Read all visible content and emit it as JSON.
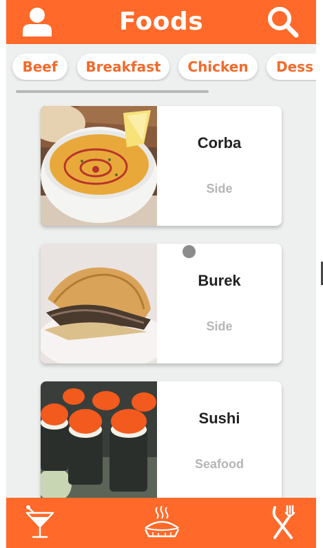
{
  "header": {
    "title": "Foods",
    "profile_icon": "person-icon",
    "search_icon": "search-icon"
  },
  "categories": [
    "Beef",
    "Breakfast",
    "Chicken",
    "Dess"
  ],
  "foods": [
    {
      "name": "Corba",
      "category": "Side",
      "image": "lentil-soup-photo"
    },
    {
      "name": "Burek",
      "category": "Side",
      "image": "burek-pastry-photo"
    },
    {
      "name": "Sushi",
      "category": "Seafood",
      "image": "sushi-rolls-photo"
    }
  ],
  "bottom_nav": {
    "items": [
      "cocktail-icon",
      "pie-icon",
      "fork-knife-icon"
    ]
  },
  "colors": {
    "accent": "#ff6a2a",
    "background": "#eef0ef",
    "card": "#ffffff",
    "muted_text": "#b5b5b5"
  }
}
